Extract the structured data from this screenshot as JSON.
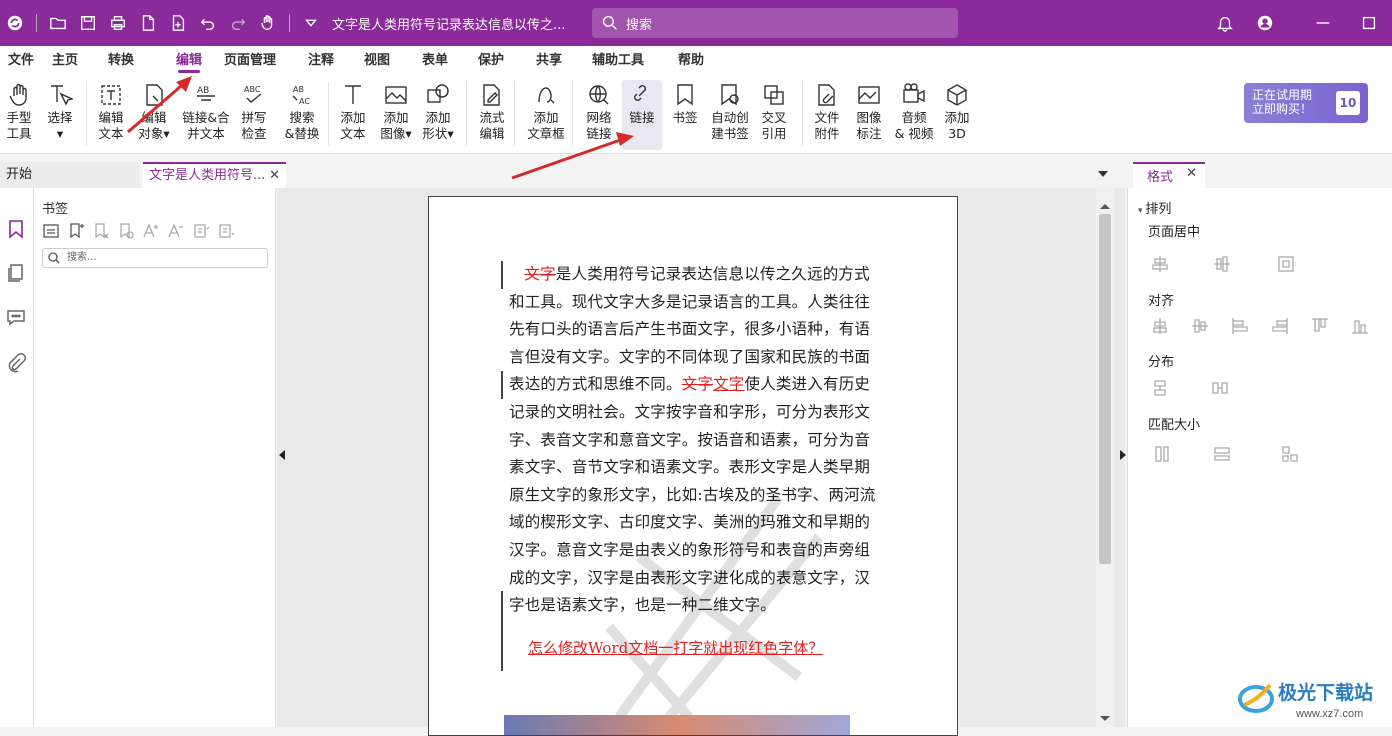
{
  "titlebar": {
    "doc_title": "文字是人类用符号记录表达信息以传之...",
    "search_placeholder": "搜索"
  },
  "menu": [
    "文件",
    "主页",
    "转换",
    "编辑",
    "页面管理",
    "注释",
    "视图",
    "表单",
    "保护",
    "共享",
    "辅助工具",
    "帮助"
  ],
  "active_menu": "编辑",
  "ribbon": [
    {
      "l1": "手型",
      "l2": "工具"
    },
    {
      "l1": "选择",
      "l2": "▾"
    },
    {
      "l1": "编辑",
      "l2": "文本"
    },
    {
      "l1": "编辑",
      "l2": "对象▾"
    },
    {
      "l1": "链接&合",
      "l2": "并文本"
    },
    {
      "l1": "拼写",
      "l2": "检查"
    },
    {
      "l1": "搜索",
      "l2": "&替换"
    },
    {
      "l1": "添加",
      "l2": "文本"
    },
    {
      "l1": "添加",
      "l2": "图像▾"
    },
    {
      "l1": "添加",
      "l2": "形状▾"
    },
    {
      "l1": "流式",
      "l2": "编辑"
    },
    {
      "l1": "添加",
      "l2": "文章框"
    },
    {
      "l1": "网络",
      "l2": "链接"
    },
    {
      "l1": "链接",
      "l2": ""
    },
    {
      "l1": "书签",
      "l2": ""
    },
    {
      "l1": "自动创",
      "l2": "建书签"
    },
    {
      "l1": "交叉",
      "l2": "引用"
    },
    {
      "l1": "文件",
      "l2": "附件"
    },
    {
      "l1": "图像",
      "l2": "标注"
    },
    {
      "l1": "音频",
      "l2": "& 视频"
    },
    {
      "l1": "添加",
      "l2": "3D"
    }
  ],
  "promo": {
    "line1": "正在试用期",
    "line2": "立即购买！",
    "days": "10"
  },
  "tabs": {
    "start": "开始",
    "doc": "文字是人类用符号...",
    "close": "✕"
  },
  "left_panel": {
    "title": "书签",
    "search_placeholder": "搜索..."
  },
  "document": {
    "p1_strike": "文字",
    "p1_rest": "是人类用符号记录表达信息以传之久远的方式和工具。现代文字大多是记录语言的工具。人类往往先有口头的语言后产生书面文字，很多小语种，有语言但没有文字。文字的不同体现了国家和民族的书面表达的方式和思维不同。",
    "p1_strike2": "文字",
    "p1_uline": "文字",
    "p1_tail": "使人类进入有历史记录的文明社会。文字按字音和字形，可分为表形文字、表音文字和意音文字。按语音和语素，可分为音素文字、音节文字和语素文字。表形文字是人类早期原生文字的象形文字，比如:古埃及的圣书字、两河流域的楔形文字、古印度文字、美洲的玛雅文和早期的汉字。意音文字是由表义的象形符号和表音的声旁组成的文字，汉字是由表形文字进化成的表意文字，汉字也是语素文字，也是一种二维文字。",
    "link_text": "怎么修改Word文档一打字就出现红色字体？"
  },
  "right_panel": {
    "tab": "格式",
    "section": "排列",
    "groups": [
      "页面居中",
      "对齐",
      "分布",
      "匹配大小"
    ]
  },
  "watermark_logo": {
    "brand": "极光下载站",
    "url": "www.xz7.com"
  },
  "colors": {
    "accent": "#8b2a9b",
    "link_red": "#e02020",
    "arrow": "#d42a2a"
  }
}
